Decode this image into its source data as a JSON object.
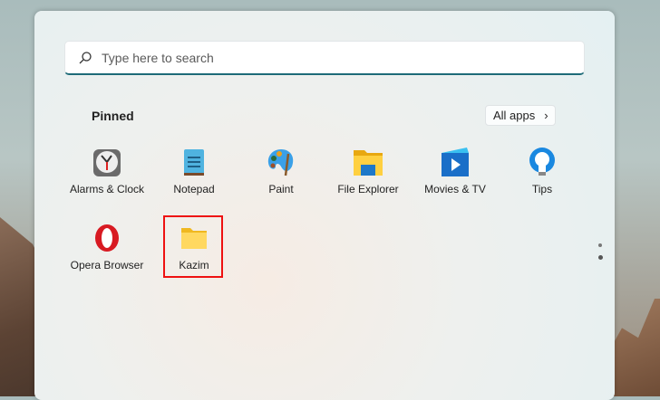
{
  "search": {
    "placeholder": "Type here to search"
  },
  "pinned_label": "Pinned",
  "all_apps_label": "All apps",
  "apps": [
    {
      "label": "Alarms & Clock",
      "icon": "alarm-clock-icon"
    },
    {
      "label": "Notepad",
      "icon": "notepad-icon"
    },
    {
      "label": "Paint",
      "icon": "paint-palette-icon"
    },
    {
      "label": "File Explorer",
      "icon": "file-explorer-icon"
    },
    {
      "label": "Movies & TV",
      "icon": "movies-tv-icon"
    },
    {
      "label": "Tips",
      "icon": "lightbulb-icon"
    },
    {
      "label": "Opera Browser",
      "icon": "opera-icon"
    },
    {
      "label": "Kazim",
      "icon": "folder-icon"
    }
  ],
  "colors": {
    "highlight": "#ee1111",
    "search_accent": "#1e6b78"
  }
}
